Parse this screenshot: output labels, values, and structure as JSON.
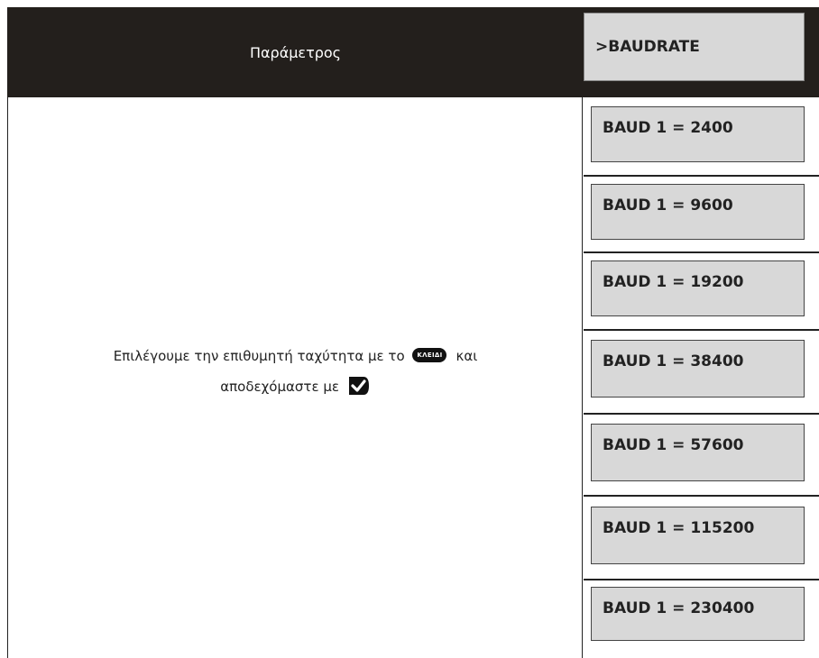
{
  "header": {
    "parameter_label": "Παράμετρος",
    "display_text": ">BAUDRATE"
  },
  "description": {
    "line1_before_key": "Επιλέγουμε την επιθυμητή ταχύτητα με το",
    "key_label": "ΚΛΕΙΔΙ",
    "line1_after_key": "και",
    "line2": "αποδεχόμαστε με",
    "check_key_icon": "check-key-icon"
  },
  "options": [
    "BAUD 1 = 2400",
    "BAUD 1 = 9600",
    "BAUD 1 = 19200",
    "BAUD 1 = 38400",
    "BAUD 1 = 57600",
    "BAUD 1 = 115200",
    "BAUD 1 = 230400"
  ],
  "colors": {
    "header_bg": "#231f1c",
    "lcd_bg": "#d8d8d8"
  }
}
